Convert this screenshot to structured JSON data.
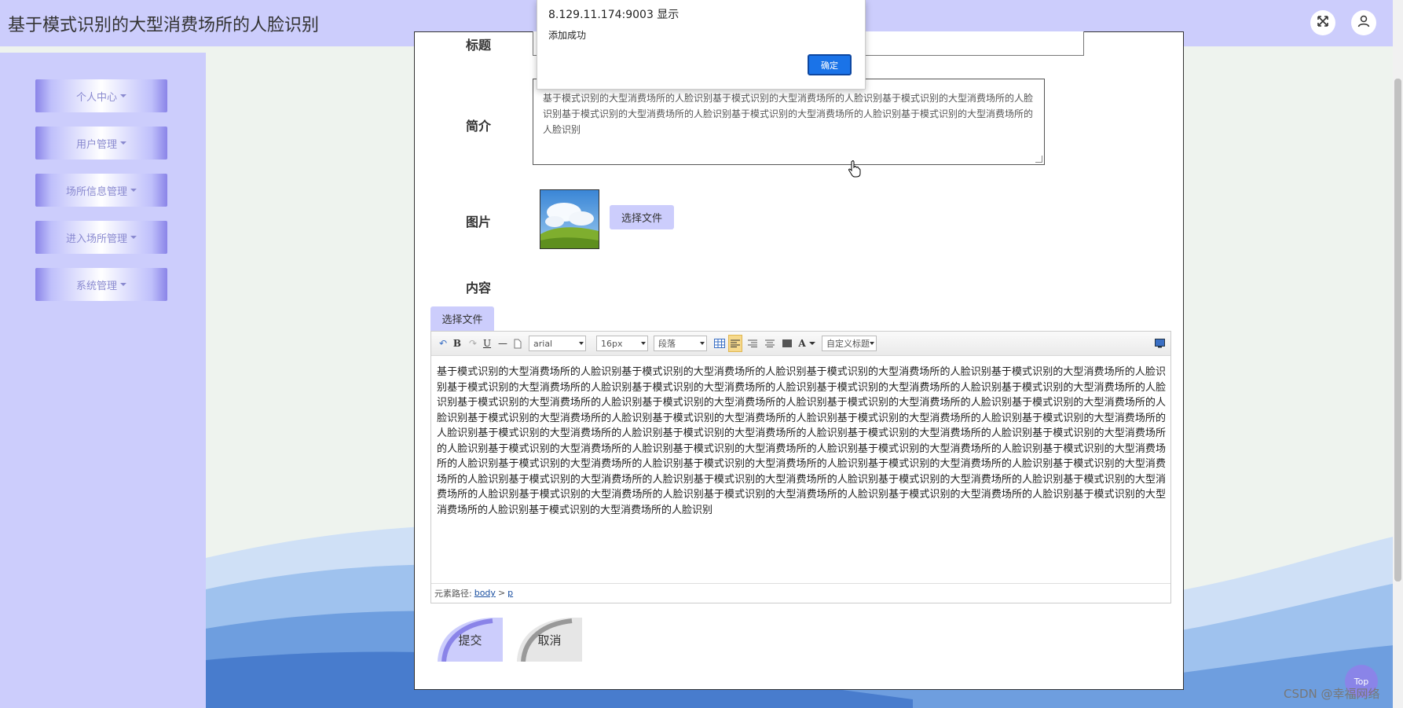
{
  "header": {
    "title": "基于模式识别的大型消费场所的人脸识别",
    "icons": [
      "fullscreen-icon",
      "user-icon"
    ]
  },
  "sidebar": {
    "items": [
      {
        "label": "个人中心"
      },
      {
        "label": "用户管理"
      },
      {
        "label": "场所信息管理"
      },
      {
        "label": "进入场所管理"
      },
      {
        "label": "系统管理"
      }
    ]
  },
  "form": {
    "title_label": "标题",
    "intro_label": "简介",
    "intro_value": "基于模式识别的大型消费场所的人脸识别基于模式识别的大型消费场所的人脸识别基于模式识别的大型消费场所的人脸识别基于模式识别的大型消费场所的人脸识别基于模式识别的大型消费场所的人脸识别基于模式识别的大型消费场所的人脸识别",
    "image_label": "图片",
    "choose_file": "选择文件",
    "content_label": "内容",
    "content_choose_file": "选择文件",
    "submit_label": "提交",
    "cancel_label": "取消"
  },
  "editor": {
    "font_family": "arial",
    "font_size": "16px",
    "paragraph": "段落",
    "custom_heading": "自定义标题",
    "bold": "B",
    "underline": "U",
    "font_color": "A",
    "body_text": "基于模式识别的大型消费场所的人脸识别基于模式识别的大型消费场所的人脸识别基于模式识别的大型消费场所的人脸识别基于模式识别的大型消费场所的人脸识别基于模式识别的大型消费场所的人脸识别基于模式识别的大型消费场所的人脸识别基于模式识别的大型消费场所的人脸识别基于模式识别的大型消费场所的人脸识别基于模式识别的大型消费场所的人脸识别基于模式识别的大型消费场所的人脸识别基于模式识别的大型消费场所的人脸识别基于模式识别的大型消费场所的人脸识别基于模式识别的大型消费场所的人脸识别基于模式识别的大型消费场所的人脸识别基于模式识别的大型消费场所的人脸识别基于模式识别的大型消费场所的人脸识别基于模式识别的大型消费场所的人脸识别基于模式识别的大型消费场所的人脸识别基于模式识别的大型消费场所的人脸识别基于模式识别的大型消费场所的人脸识别基于模式识别的大型消费场所的人脸识别基于模式识别的大型消费场所的人脸识别基于模式识别的大型消费场所的人脸识别基于模式识别的大型消费场所的人脸识别基于模式识别的大型消费场所的人脸识别基于模式识别的大型消费场所的人脸识别基于模式识别的大型消费场所的人脸识别基于模式识别的大型消费场所的人脸识别基于模式识别的大型消费场所的人脸识别基于模式识别的大型消费场所的人脸识别基于模式识别的大型消费场所的人脸识别基于模式识别的大型消费场所的人脸识别基于模式识别的大型消费场所的人脸识别基于模式识别的大型消费场所的人脸识别基于模式识别的大型消费场所的人脸识别基于模式识别的大型消费场所的人脸识别基于模式识别的大型消费场所的人脸识别",
    "path_label": "元素路径:",
    "path_body": "body",
    "path_sep": ">",
    "path_p": "p"
  },
  "alert": {
    "origin": "8.129.11.174:9003 显示",
    "message": "添加成功",
    "ok_label": "确定"
  },
  "top_button": "Top",
  "watermark": "CSDN @幸福网络",
  "colors": {
    "header_bg": "#cccdfc",
    "accent": "#8a84e8",
    "ok_button": "#1a73e8"
  }
}
